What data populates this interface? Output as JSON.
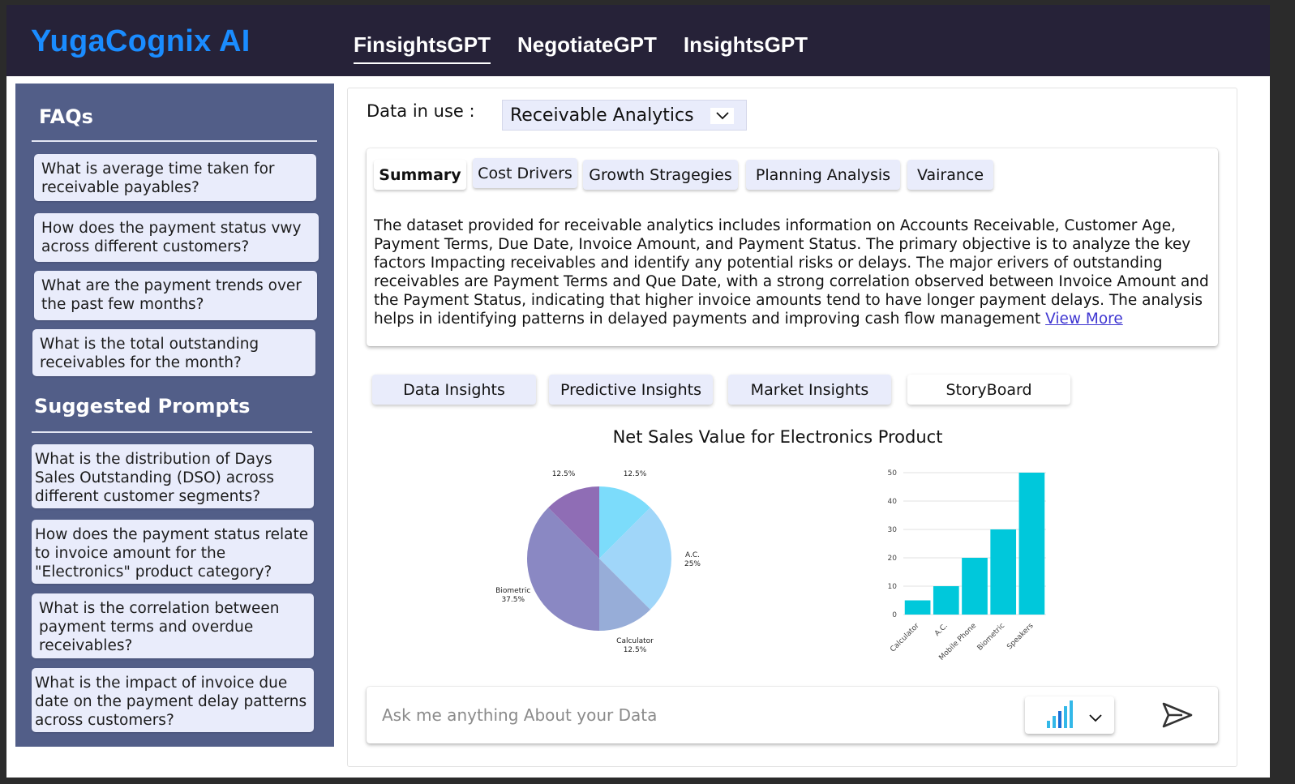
{
  "brand": "YugaCognix AI",
  "nav": [
    "FinsightsGPT",
    "NegotiateGPT",
    "InsightsGPT"
  ],
  "sidebar": {
    "faq_heading": "FAQs",
    "faqs": [
      "What is average time taken for receivable payables?",
      "How does the payment status vwy across different customers?",
      "What are the payment trends over the past few months?",
      "What is the total outstanding receivables for the month?"
    ],
    "prompts_heading": "Suggested Prompts",
    "prompts": [
      "What is the distribution of Days Sales Outstanding (DSO) across different customer segments?",
      "How does the payment status relate to invoice amount for the \"Electronics\" product category?",
      "What is the correlation between payment terms and overdue receivables?",
      "What is the impact of invoice due date on the payment delay patterns across customers?"
    ]
  },
  "main": {
    "data_label": "Data in use :",
    "data_select_value": "Receivable Analytics",
    "tabs": [
      "Summary",
      "Cost Drivers",
      "Growth Stragegies",
      "Planning Analysis",
      "Vairance"
    ],
    "summary_text": "The dataset provided for receivable analytics includes information on Accounts Receivable, Customer Age, Payment Terms, Due Date, Invoice Amount, and Payment Status. The primary objective is to analyze the key factors Impacting receivables and identify any potential risks or delays. The major erivers of outstanding receivables are Payment Terms and Que Date, with a strong correlation observed between Invoice Amount and the Payment Status, indicating that higher invoice amounts tend to have longer payment delays. The analysis helps in identifying patterns in delayed payments and improving cash flow management ",
    "view_more": "View More",
    "insight_buttons": [
      "Data Insights",
      "Predictive Insights",
      "Market Insights",
      "StoryBoard"
    ],
    "chart_title": "Net Sales Value for Electronics Product",
    "ask_placeholder": "Ask me anything About your Data"
  },
  "icons": {
    "data_select_chevron": "chevron-down-icon",
    "chart_picker": "bar-chart-icon",
    "chart_picker_chevron": "chevron-down-icon",
    "send": "send-icon"
  },
  "colors": {
    "topbar": "#262238",
    "brand": "#1a8cff",
    "sidebar": "#525e88",
    "card": "#e9ecfb",
    "link": "#3f36d1",
    "bar": "#00c8db"
  },
  "chart_data": [
    {
      "type": "pie",
      "title": "Net Sales Value for Electronics Product",
      "slices": [
        {
          "label": "",
          "value": 12.5,
          "pct_label": "12.5%",
          "color": "#7cdcfb"
        },
        {
          "label": "A.C.",
          "value": 25,
          "pct_label": "25%",
          "color": "#a0d6f9"
        },
        {
          "label": "Calculator",
          "value": 12.5,
          "pct_label": "12.5%",
          "color": "#97add8"
        },
        {
          "label": "Biometric",
          "value": 37.5,
          "pct_label": "37.5%",
          "color": "#8a88c3"
        },
        {
          "label": "",
          "value": 12.5,
          "pct_label": "12.5%",
          "color": "#8f6db5"
        }
      ]
    },
    {
      "type": "bar",
      "categories": [
        "Calculator",
        "A.C.",
        "Mobile Phone",
        "Biometric",
        "Speakers"
      ],
      "values": [
        5,
        10,
        20,
        30,
        50
      ],
      "yticks": [
        0,
        10,
        20,
        30,
        40,
        50
      ],
      "ylim": [
        0,
        50
      ],
      "color": "#00c8db",
      "grid": true
    }
  ]
}
